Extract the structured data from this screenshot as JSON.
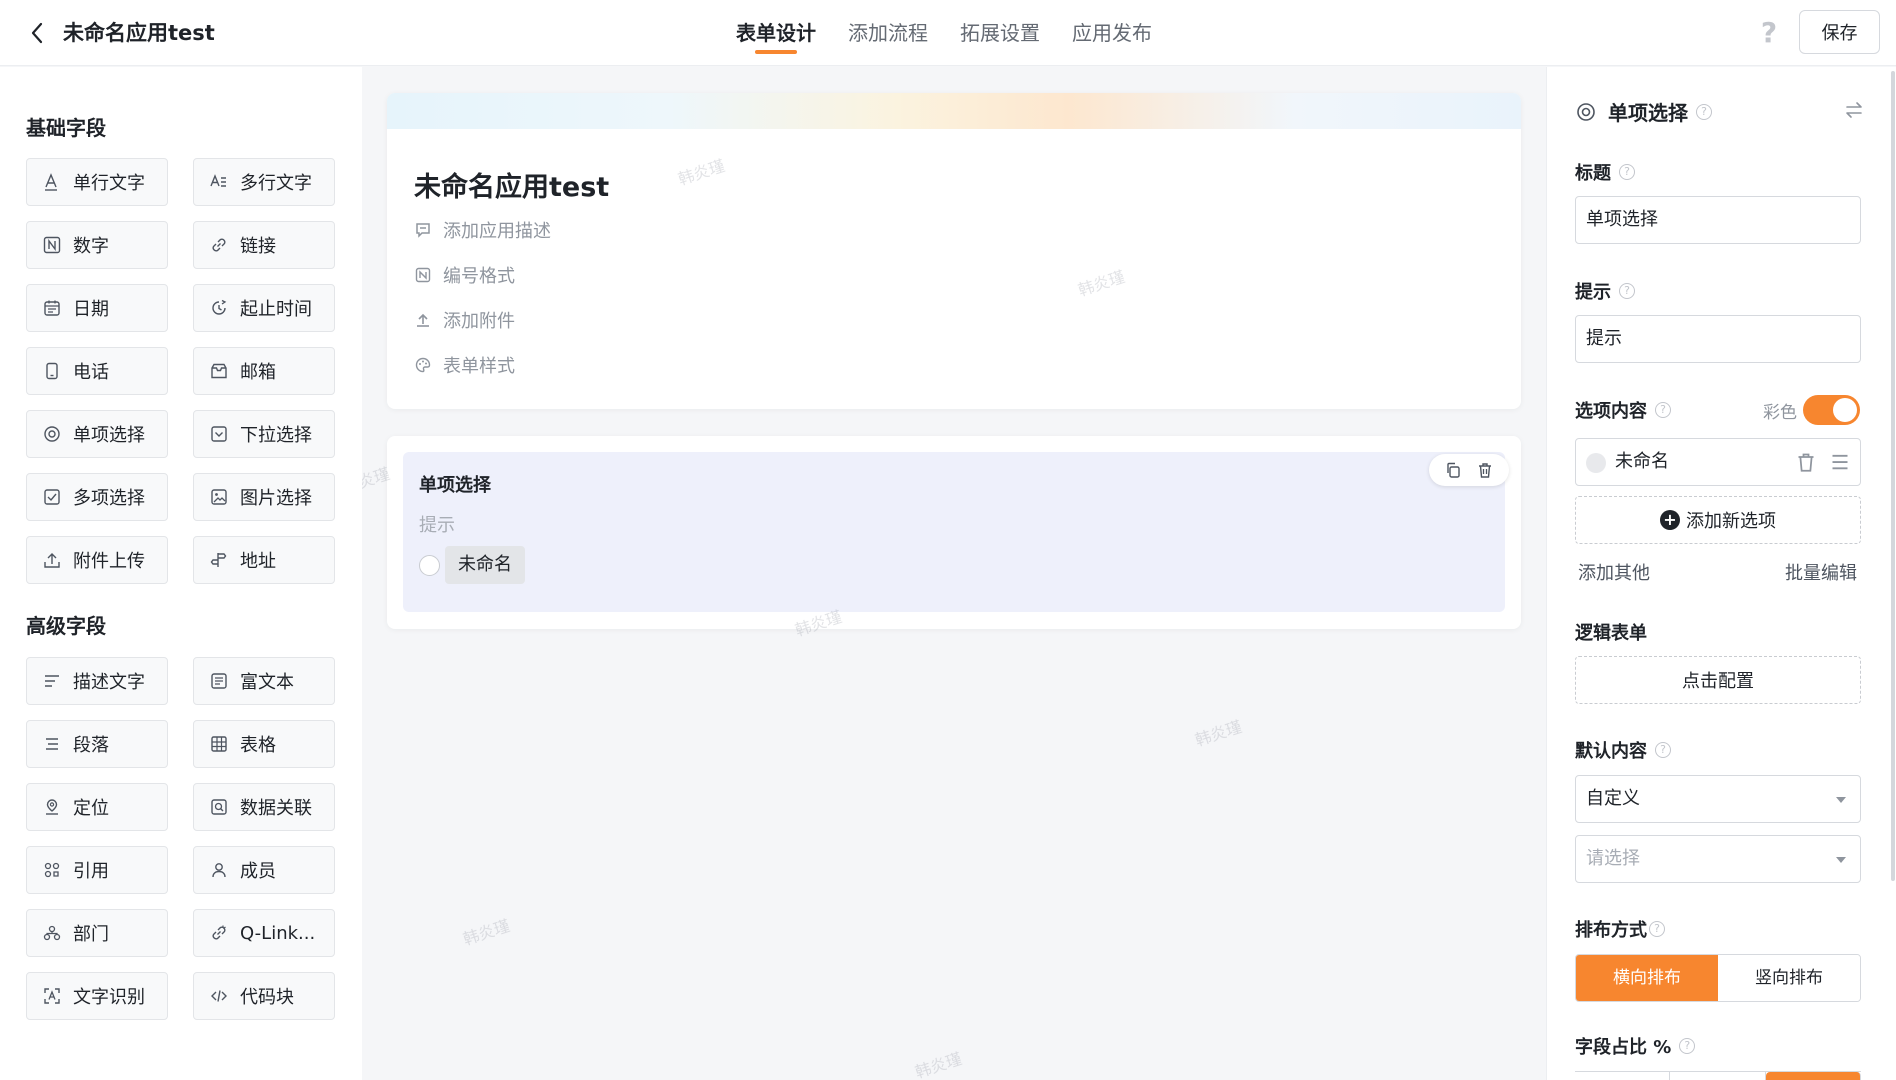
{
  "header": {
    "app_name": "未命名应用test",
    "tabs": [
      "表单设计",
      "添加流程",
      "拓展设置",
      "应用发布"
    ],
    "active_tab": 0,
    "save_label": "保存",
    "help_label": "?"
  },
  "palette": {
    "basic_title": "基础字段",
    "basic": [
      {
        "label": "单行文字",
        "icon": "text-icon"
      },
      {
        "label": "多行文字",
        "icon": "multiline-text-icon"
      },
      {
        "label": "数字",
        "icon": "number-icon"
      },
      {
        "label": "链接",
        "icon": "link-icon"
      },
      {
        "label": "日期",
        "icon": "calendar-icon"
      },
      {
        "label": "起止时间",
        "icon": "time-range-icon"
      },
      {
        "label": "电话",
        "icon": "phone-icon"
      },
      {
        "label": "邮箱",
        "icon": "mail-icon"
      },
      {
        "label": "单项选择",
        "icon": "radio-icon"
      },
      {
        "label": "下拉选择",
        "icon": "dropdown-icon"
      },
      {
        "label": "多项选择",
        "icon": "checkbox-icon"
      },
      {
        "label": "图片选择",
        "icon": "image-icon"
      },
      {
        "label": "附件上传",
        "icon": "upload-icon"
      },
      {
        "label": "地址",
        "icon": "address-icon"
      }
    ],
    "advanced_title": "高级字段",
    "advanced": [
      {
        "label": "描述文字",
        "icon": "description-icon"
      },
      {
        "label": "富文本",
        "icon": "rich-text-icon"
      },
      {
        "label": "段落",
        "icon": "paragraph-icon"
      },
      {
        "label": "表格",
        "icon": "table-icon"
      },
      {
        "label": "定位",
        "icon": "location-icon"
      },
      {
        "label": "数据关联",
        "icon": "data-link-icon"
      },
      {
        "label": "引用",
        "icon": "reference-icon"
      },
      {
        "label": "成员",
        "icon": "member-icon"
      },
      {
        "label": "部门",
        "icon": "department-icon"
      },
      {
        "label": "Q-Link...",
        "icon": "qlink-icon"
      },
      {
        "label": "文字识别",
        "icon": "ocr-icon"
      },
      {
        "label": "代码块",
        "icon": "code-icon"
      }
    ]
  },
  "canvas": {
    "form_title": "未命名应用test",
    "meta": [
      {
        "label": "添加应用描述",
        "icon": "comment-icon"
      },
      {
        "label": "编号格式",
        "icon": "number-format-icon"
      },
      {
        "label": "添加附件",
        "icon": "upload-icon"
      },
      {
        "label": "表单样式",
        "icon": "palette-icon"
      }
    ],
    "field": {
      "label": "单项选择",
      "hint": "提示",
      "option": "未命名"
    },
    "watermark": "韩炎瑾"
  },
  "props": {
    "title": "单项选择",
    "title_label": "标题",
    "title_value": "单项选择",
    "hint_label": "提示",
    "hint_value": "提示",
    "options_label": "选项内容",
    "color_label": "彩色",
    "color_enabled": true,
    "options": [
      "未命名"
    ],
    "add_option": "添加新选项",
    "add_other": "添加其他",
    "batch_edit": "批量编辑",
    "logic_label": "逻辑表单",
    "logic_button": "点击配置",
    "default_label": "默认内容",
    "default_mode": "自定义",
    "default_placeholder": "请选择",
    "layout_label": "排布方式",
    "layout_options": [
      "横向排布",
      "竖向排布"
    ],
    "layout_selected": "横向排布",
    "ratio_label": "字段占比 %",
    "accent_color": "#f7862f"
  }
}
